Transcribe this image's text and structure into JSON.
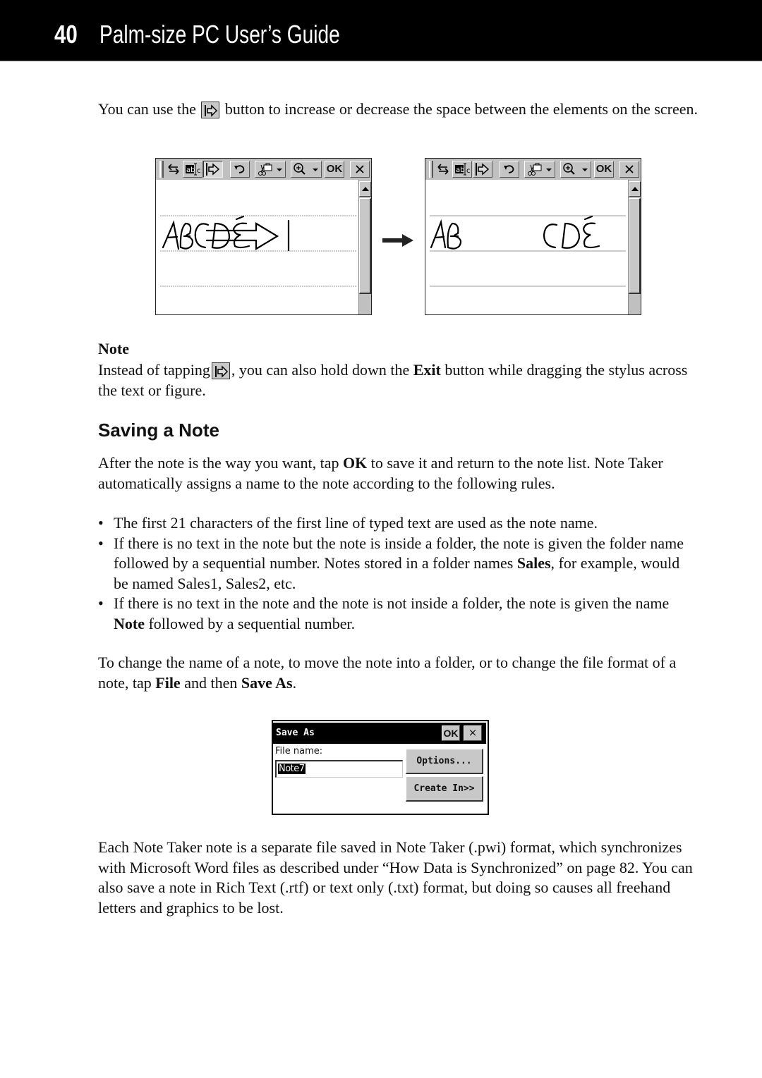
{
  "header": {
    "page_number": "40",
    "guide_title": "Palm-size PC User’s Guide"
  },
  "intro": {
    "before_icon": "You can use the",
    "icon": "space-insert-icon",
    "after_icon": "button to increase or decrease the space between the elements on the screen."
  },
  "figure_1": {
    "before": {
      "toolbar": [
        "grip",
        "pen-select-toggle-icon",
        "text-select-icon",
        "space-insert-icon",
        "undo-icon",
        "cut-paste-menu-icon",
        "zoom-menu-icon",
        "OK",
        "close-icon"
      ],
      "handwriting": "ABCDE with insert arrow"
    },
    "transition_icon": "right-arrow-icon",
    "after": {
      "toolbar": [
        "grip",
        "pen-select-toggle-icon",
        "text-select-icon",
        "space-insert-icon",
        "undo-icon",
        "cut-paste-menu-icon",
        "zoom-menu-icon",
        "OK",
        "close-icon"
      ],
      "handwriting_left": "AB",
      "handwriting_right": "CDE"
    },
    "ok_label": "OK"
  },
  "note": {
    "heading": "Note",
    "text_1": "Instead of tapping",
    "text_2": ", you can also hold down the",
    "bold_exit": "Exit",
    "text_3": "button while dragging the stylus across the text or figure."
  },
  "section": {
    "heading": "Saving a Note",
    "para_1_a": "After the note is the way you want, tap",
    "para_1_bold": "OK",
    "para_1_b": "to save it and return to the note list. Note Taker automatically assigns a name to the note according to the following rules.",
    "bullets": [
      {
        "text": "The first 21 characters of the first line of typed text are used as the note name."
      },
      {
        "a": "If there is no text in the note but the note is inside a folder, the note is given the folder name followed by a sequential number. Notes stored in a folder names",
        "bold": "Sales",
        "b": ", for example, would be named Sales1, Sales2, etc."
      },
      {
        "a": "If there is no text in the note and the note is not inside a folder, the note is given the name",
        "bold": "Note",
        "b": "followed by a sequential number."
      }
    ],
    "para_2_a": "To change the name of a note, to move the note into a folder, or to change the file format of a note, tap",
    "para_2_bold_1": "File",
    "para_2_mid": "and then",
    "para_2_bold_2": "Save As",
    "para_2_end": ".",
    "para_3": "Each Note Taker note is a separate file saved in Note Taker (.pwi) format, which synchronizes with Microsoft Word files as described under “How Data is Synchronized” on page 82. You can also save a note in  Rich Text (.rtf) or text only (.txt) format, but doing so causes all freehand letters and graphics to be lost."
  },
  "save_as_dialog": {
    "title": "Save As",
    "ok_label": "OK",
    "close_label": "×",
    "file_name_label": "File name:",
    "file_name_value": "Note7",
    "options_button": "Options...",
    "create_in_button": "Create In>>"
  }
}
